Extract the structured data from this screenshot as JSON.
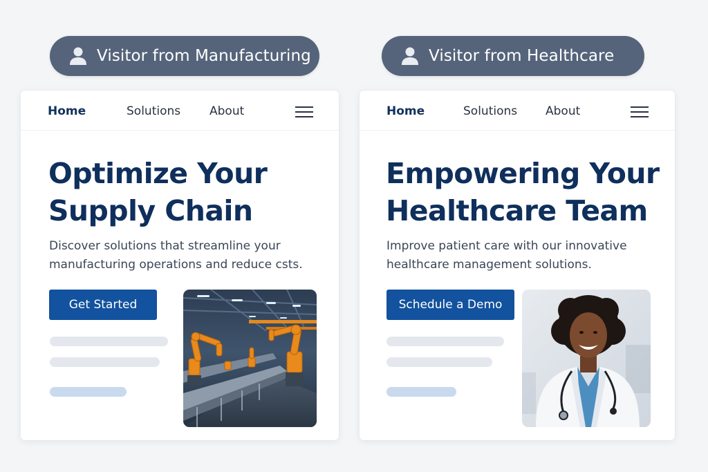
{
  "badges": {
    "left": {
      "label": "Visitor from Manufacturing",
      "icon": "user-icon"
    },
    "right": {
      "label": "Visitor from Healthcare",
      "icon": "user-icon"
    }
  },
  "colors": {
    "badge_bg": "#55647a",
    "headline": "#0f2f5c",
    "cta": "#12529e",
    "placeholder": "#e4e8ee",
    "placeholder_accent": "#c9d9ee"
  },
  "manufacturing": {
    "nav": {
      "home": "Home",
      "solutions": "Solutions",
      "about": "About",
      "menu_icon": "hamburger-menu-icon"
    },
    "headline_line1": "Optimize Your",
    "headline_line2": "Supply Chain",
    "subtitle_line1": "Discover solutions that streamline your",
    "subtitle_line2": "manufacturing operations and reduce csts.",
    "cta": "Get Started",
    "image": "factory-robot-arms-photo"
  },
  "healthcare": {
    "nav": {
      "home": "Home",
      "solutions": "Solutions",
      "about": "About",
      "menu_icon": "hamburger-menu-icon"
    },
    "headline_line1": "Empowering Your",
    "headline_line2": "Healthcare Team",
    "subtitle_line1": "Improve patient care with our innovative",
    "subtitle_line2": "healthcare management solutions.",
    "cta": "Schedule a Demo",
    "image": "doctor-with-stethoscope-photo"
  }
}
